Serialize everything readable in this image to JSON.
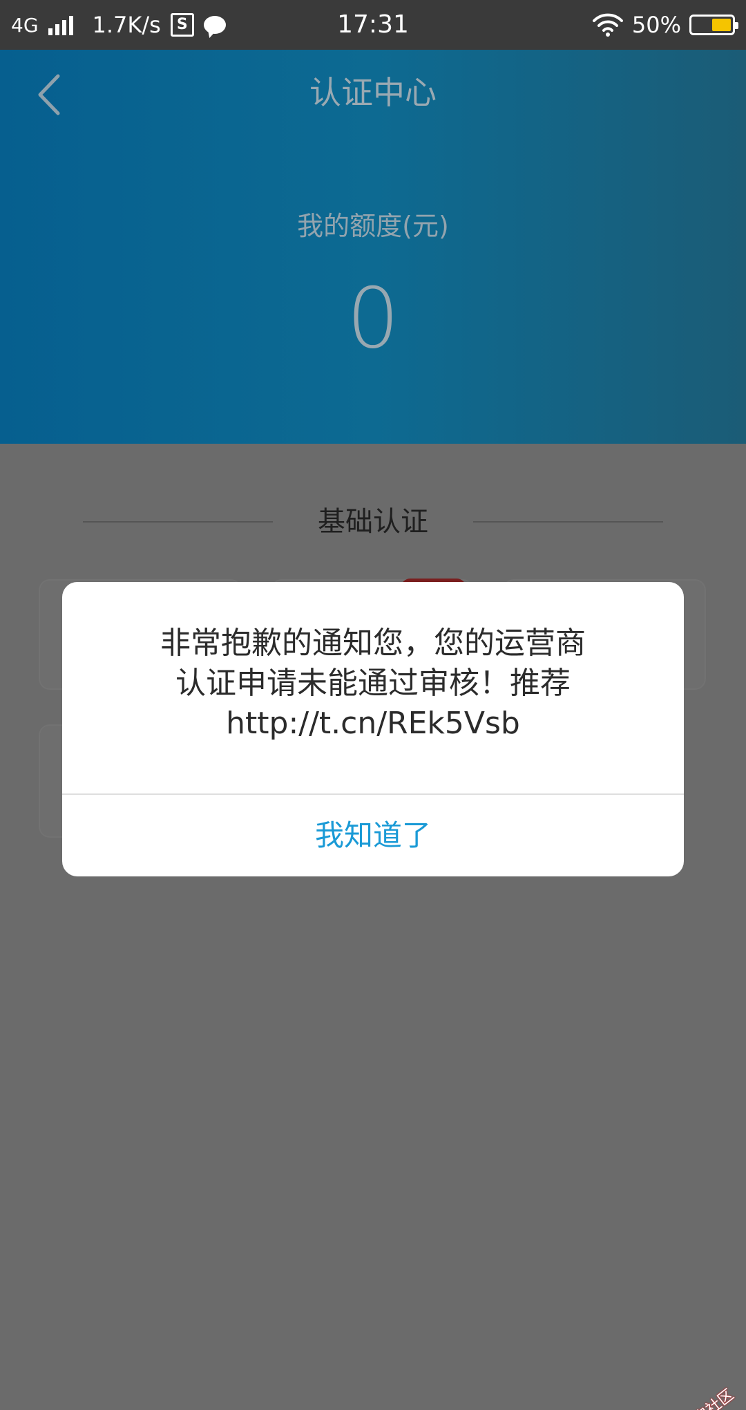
{
  "status_bar": {
    "network": "4G",
    "speed": "1.7K/s",
    "time": "17:31",
    "battery": "50%",
    "battery_level": 0.5
  },
  "header": {
    "title": "认证中心",
    "quota_label": "我的额度(元)",
    "quota_value": "0"
  },
  "section": {
    "title": "基础认证"
  },
  "dialog": {
    "message": "非常抱歉的通知您，您的运营商\n认证申请未能通过审核！推荐\nhttp://t.cn/REk5Vsb",
    "button_label": "我知道了"
  },
  "watermark": {
    "text": "卡农社区"
  },
  "colors": {
    "accent": "#1a9ad6",
    "header_blue": "#0d6a92",
    "overlay": "#6b6b6b",
    "battery": "#f5c400"
  }
}
